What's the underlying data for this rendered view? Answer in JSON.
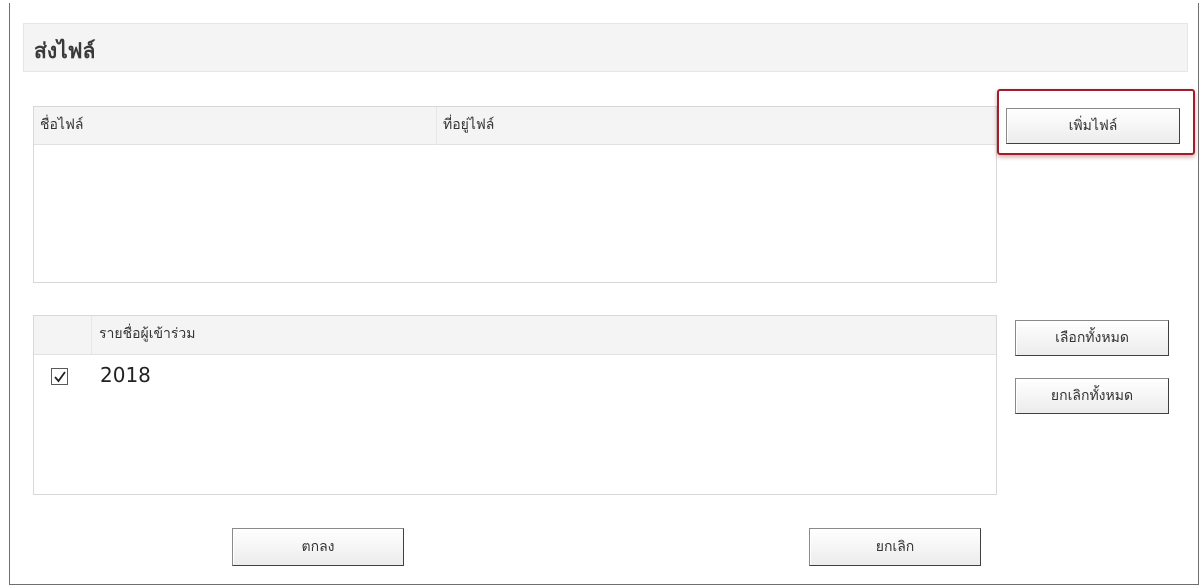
{
  "dialog": {
    "title": "ส่งไฟล์"
  },
  "files_table": {
    "columns": [
      "ชื่อไฟล์",
      "ที่อยู่ไฟล์"
    ],
    "rows": []
  },
  "add_file_button": "เพิ่มไฟล์",
  "participants_table": {
    "header": "รายชื่อผู้เข้าร่วม",
    "rows": [
      {
        "checked": true,
        "name": "2018"
      }
    ]
  },
  "select_all_button": "เลือกทั้งหมด",
  "deselect_all_button": "ยกเลิกทั้งหมด",
  "ok_button": "ตกลง",
  "cancel_button": "ยกเลิก",
  "colors": {
    "highlight": "#a21d2b",
    "header_bg": "#f4f4f4"
  }
}
